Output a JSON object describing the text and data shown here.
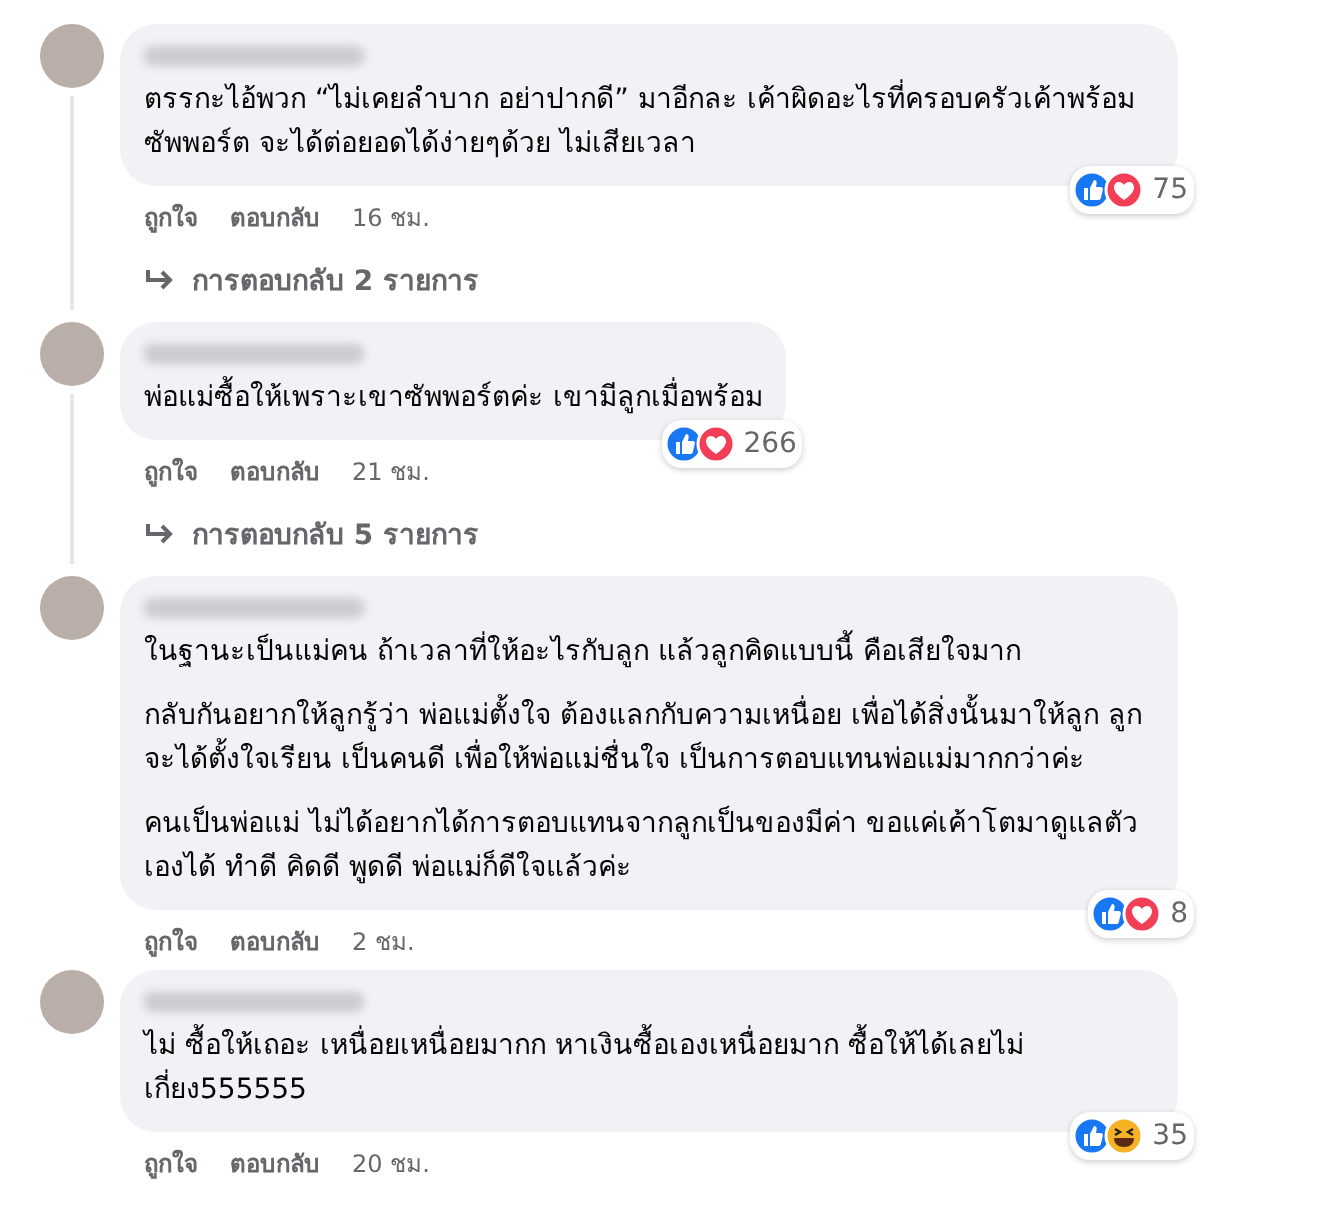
{
  "comments": [
    {
      "paragraphs": [
        "ตรรกะไอ้พวก “ไม่เคยลำบาก อย่าปากดี” มาอีกละ เค้าผิดอะไรที่ครอบครัวเค้าพร้อมซัพพอร์ต จะได้ต่อยอดได้ง่ายๆด้วย ไม่เสียเวลา"
      ],
      "reactions": [
        {
          "kind": "like"
        },
        {
          "kind": "love"
        }
      ],
      "reaction_count": "75",
      "actions": [
        "ถูกใจ",
        "ตอบกลับ"
      ],
      "time": "16 ชม.",
      "replies": "การตอบกลับ 2 รายการ"
    },
    {
      "paragraphs": [
        "พ่อแม่ซื้อให้เพราะเขาซัพพอร์ตค่ะ เขามีลูกเมื่อพร้อม"
      ],
      "reactions": [
        {
          "kind": "like"
        },
        {
          "kind": "love"
        }
      ],
      "reaction_count": "266",
      "actions": [
        "ถูกใจ",
        "ตอบกลับ"
      ],
      "time": "21 ชม.",
      "replies": "การตอบกลับ 5 รายการ"
    },
    {
      "paragraphs": [
        "ในฐานะเป็นแม่คน ถ้าเวลาที่ให้อะไรกับลูก แล้วลูกคิดแบบนี้ คือเสียใจมาก",
        "กลับกันอยากให้ลูกรู้ว่า พ่อแม่ตั้งใจ ต้องแลกกับความเหนื่อย เพื่อได้สิ่งนั้นมาให้ลูก ลูกจะได้ตั้งใจเรียน เป็นคนดี เพื่อให้พ่อแม่ชื่นใจ เป็นการตอบแทนพ่อแม่มากกว่าค่ะ",
        "คนเป็นพ่อแม่ ไม่ได้อยากได้การตอบแทนจากลูกเป็นของมีค่า ขอแค่เค้าโตมาดูแลตัวเองได้ ทำดี คิดดี พูดดี พ่อแม่ก็ดีใจแล้วค่ะ"
      ],
      "reactions": [
        {
          "kind": "like"
        },
        {
          "kind": "love"
        }
      ],
      "reaction_count": "8",
      "actions": [
        "ถูกใจ",
        "ตอบกลับ"
      ],
      "time": "2 ชม."
    },
    {
      "paragraphs": [
        "ไม่ ซื้อให้เถอะ เหนื่อยเหนื่อยมากก หาเงินซื้อเองเหนื่อยมาก ซื้อให้ได้เลยไม่เกี่ยง555555"
      ],
      "reactions": [
        {
          "kind": "like"
        },
        {
          "kind": "haha"
        }
      ],
      "reaction_count": "35",
      "actions": [
        "ถูกใจ",
        "ตอบกลับ"
      ],
      "time": "20 ชม."
    }
  ]
}
